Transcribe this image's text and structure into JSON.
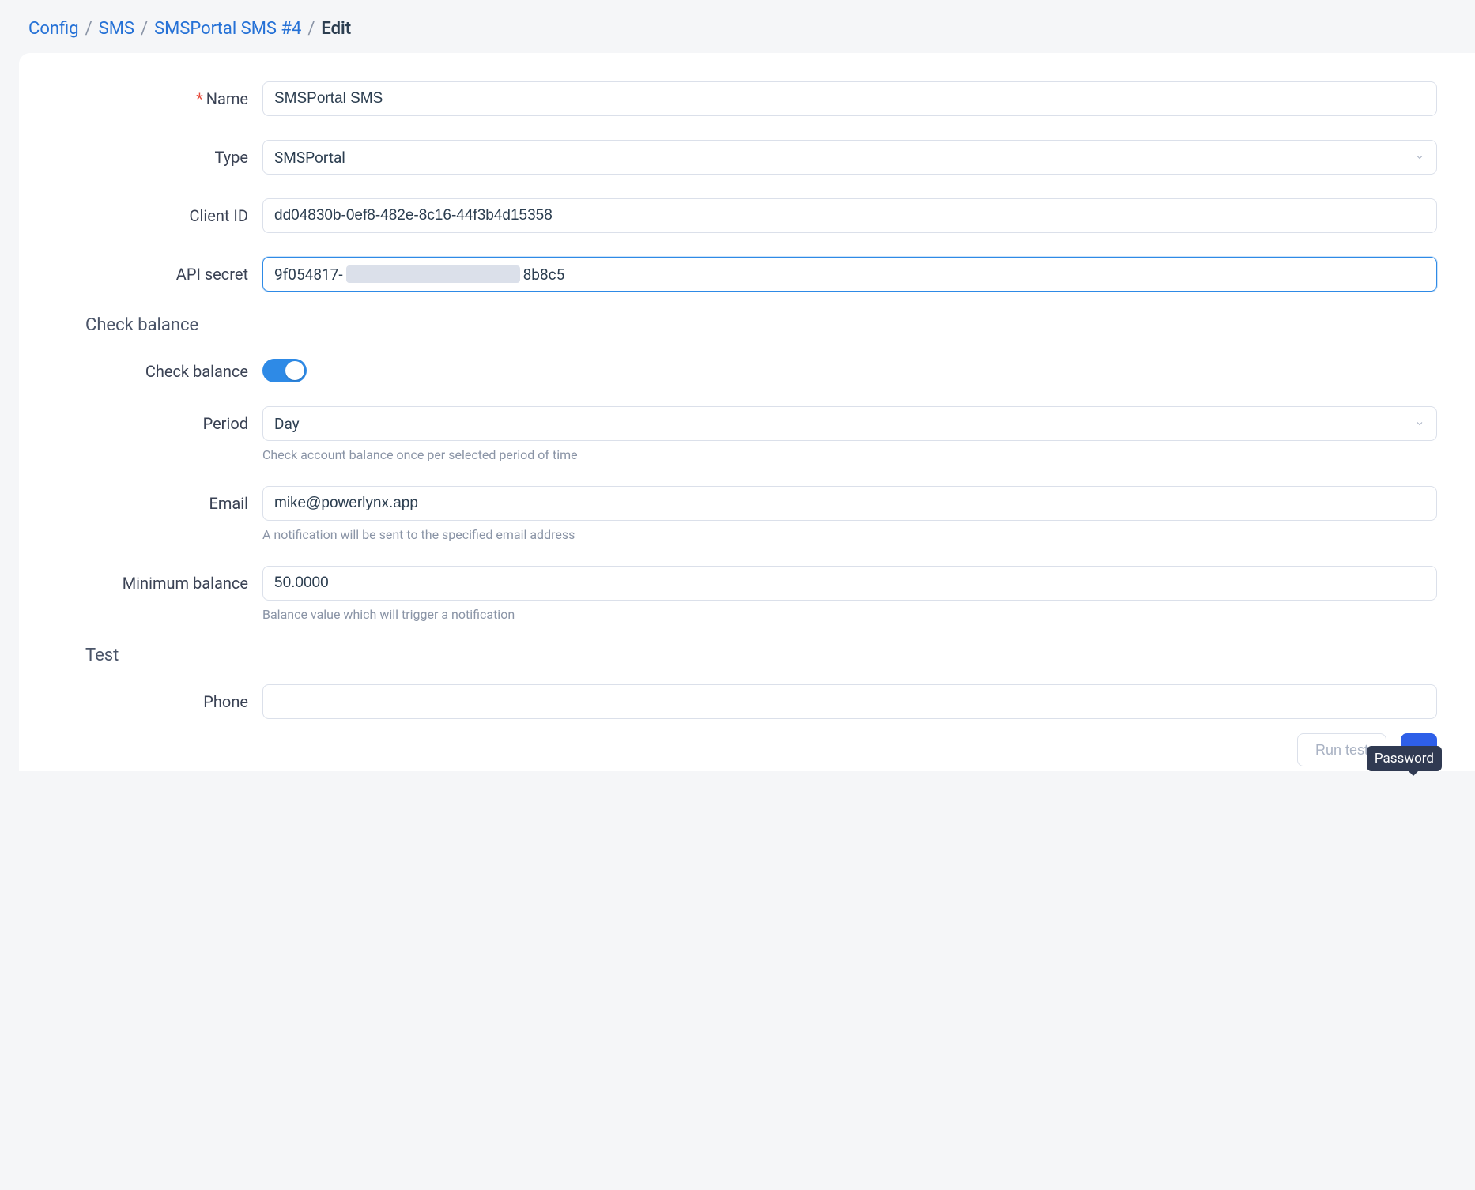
{
  "breadcrumb": {
    "items": [
      {
        "label": "Config"
      },
      {
        "label": "SMS"
      },
      {
        "label": "SMSPortal SMS #4"
      }
    ],
    "current": "Edit"
  },
  "form": {
    "name": {
      "label": "Name",
      "value": "SMSPortal SMS",
      "required": true
    },
    "type": {
      "label": "Type",
      "value": "SMSPortal"
    },
    "client_id": {
      "label": "Client ID",
      "value": "dd04830b-0ef8-482e-8c16-44f3b4d15358"
    },
    "api_secret": {
      "label": "API secret",
      "prefix": "9f054817-",
      "suffix": "8b8c5"
    }
  },
  "sections": {
    "check_balance_title": "Check balance",
    "test_title": "Test"
  },
  "check_balance": {
    "toggle_label": "Check balance",
    "toggle_on": true,
    "period": {
      "label": "Period",
      "value": "Day",
      "hint": "Check account balance once per selected period of time"
    },
    "email": {
      "label": "Email",
      "value": "mike@powerlynx.app",
      "hint": "A notification will be sent to the specified email address"
    },
    "min_balance": {
      "label": "Minimum balance",
      "value": "50.0000",
      "hint": "Balance value which will trigger a notification"
    }
  },
  "test": {
    "phone": {
      "label": "Phone",
      "value": ""
    }
  },
  "buttons": {
    "run_test": "Run test"
  },
  "tooltip": {
    "text": "Password"
  }
}
